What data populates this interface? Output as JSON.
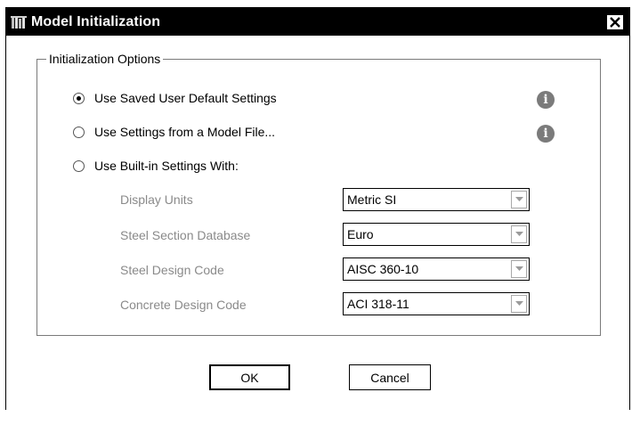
{
  "window": {
    "title": "Model Initialization",
    "close_glyph": "✕"
  },
  "group": {
    "legend": "Initialization Options"
  },
  "options": [
    {
      "label": "Use Saved User Default Settings",
      "checked": true
    },
    {
      "label": "Use Settings from a Model File...",
      "checked": false
    },
    {
      "label": "Use Built-in Settings With:",
      "checked": false
    }
  ],
  "info_icon_glyph": "i",
  "settings": [
    {
      "label": "Display Units",
      "value": "Metric SI"
    },
    {
      "label": "Steel Section Database",
      "value": "Euro"
    },
    {
      "label": "Steel Design Code",
      "value": "AISC 360-10"
    },
    {
      "label": "Concrete Design Code",
      "value": "ACI 318-11"
    }
  ],
  "buttons": {
    "ok": "OK",
    "cancel": "Cancel"
  }
}
